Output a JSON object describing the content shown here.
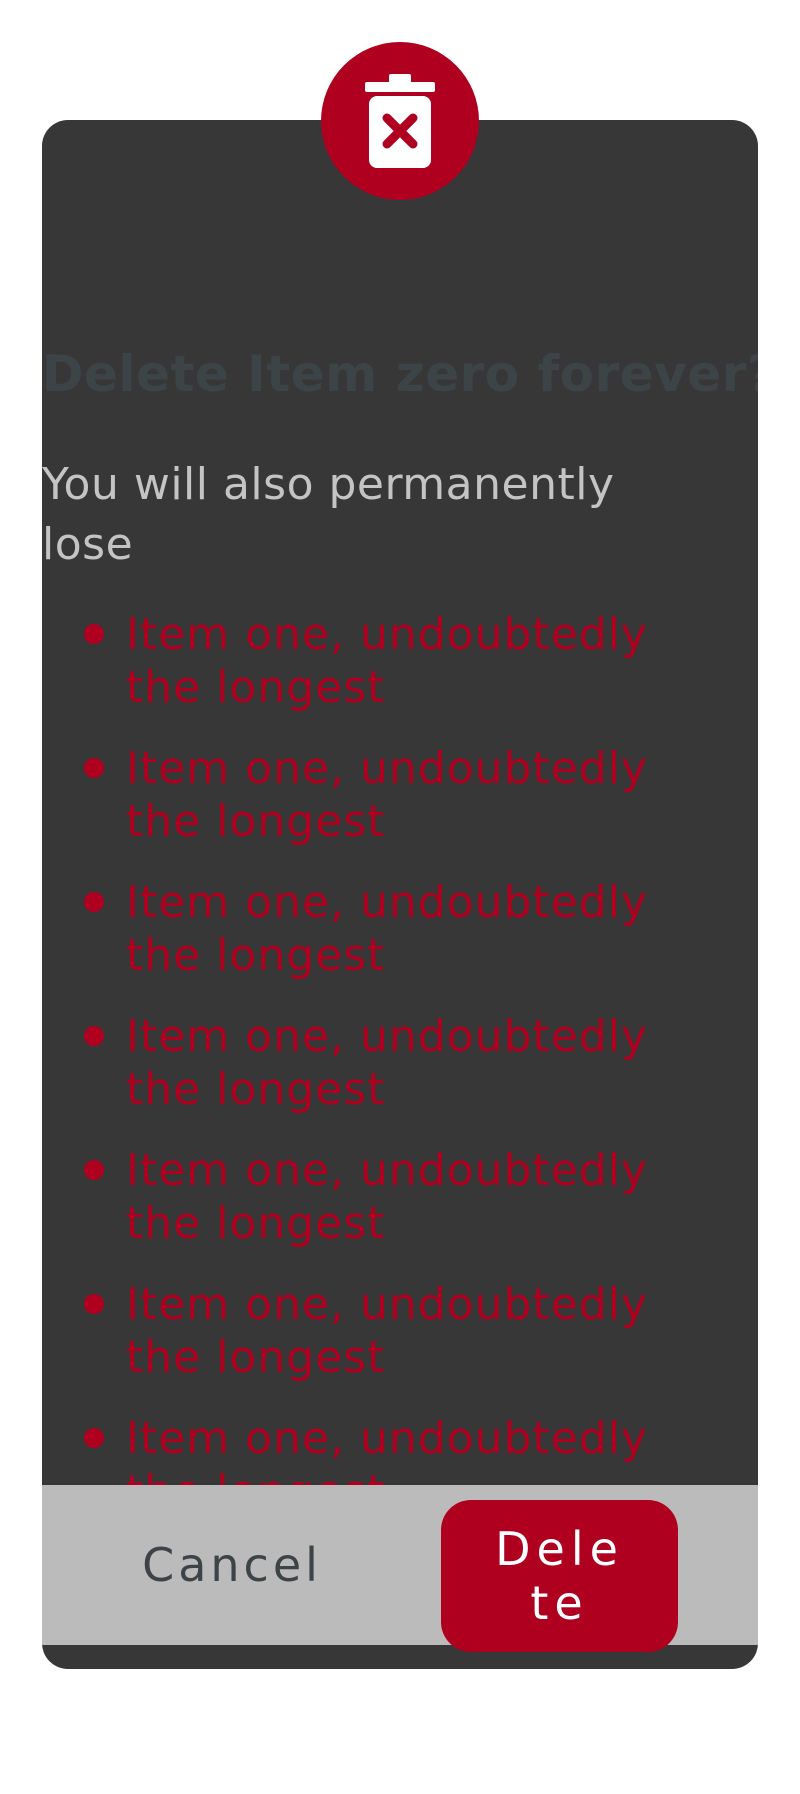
{
  "dialog": {
    "icon": "trash-delete-icon",
    "title": "Delete Item zero forever?",
    "lead": "You will also permanently lose",
    "items": [
      "Item one, undoubtedly the longest",
      "Item one, undoubtedly the longest",
      "Item one, undoubtedly the longest",
      "Item one, undoubtedly the longest",
      "Item one, undoubtedly the longest",
      "Item one, undoubtedly the longest",
      "Item one, undoubtedly the longest"
    ],
    "cancel_label": "Cancel",
    "delete_label": "Delete"
  },
  "colors": {
    "accent": "#af0020",
    "dialog_bg": "#373737",
    "footer_bg": "#bbbbbb",
    "title": "#3c4448",
    "lead": "#c4c4c4"
  }
}
